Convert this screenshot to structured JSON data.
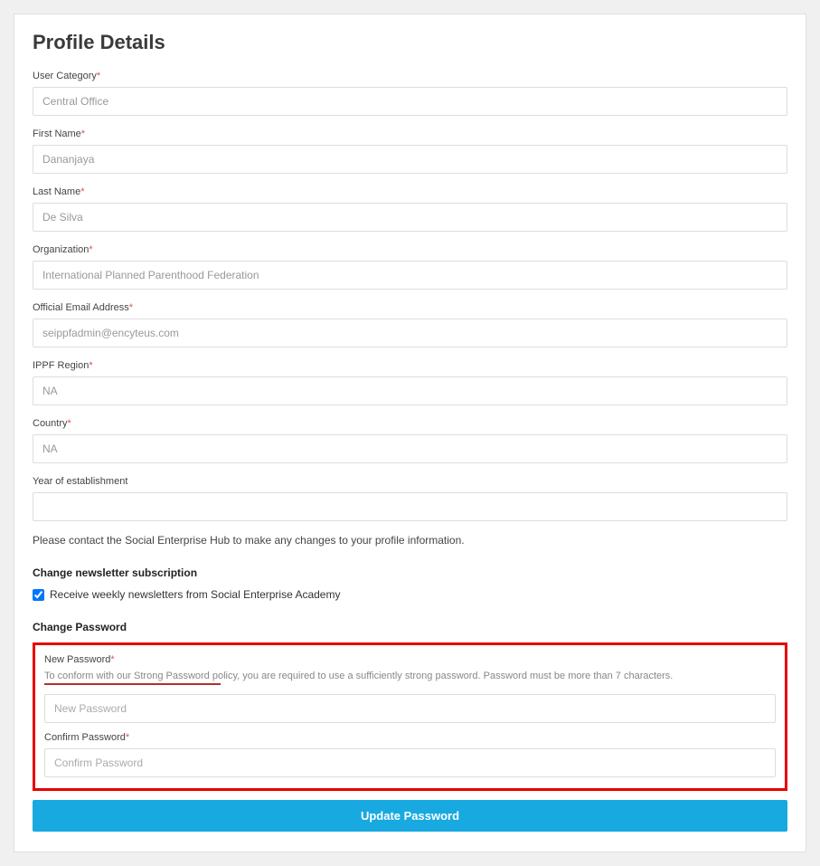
{
  "title": "Profile Details",
  "fields": {
    "user_category": {
      "label": "User Category",
      "value": "Central Office",
      "required": true
    },
    "first_name": {
      "label": "First Name",
      "value": "Dananjaya",
      "required": true
    },
    "last_name": {
      "label": "Last Name",
      "value": "De Silva",
      "required": true
    },
    "organization": {
      "label": "Organization",
      "value": "International Planned Parenthood Federation",
      "required": true
    },
    "email": {
      "label": "Official Email Address",
      "value": "seippfadmin@encyteus.com",
      "required": true
    },
    "region": {
      "label": "IPPF Region",
      "value": "NA",
      "required": true
    },
    "country": {
      "label": "Country",
      "value": "NA",
      "required": true
    },
    "year": {
      "label": "Year of establishment",
      "value": "",
      "required": false
    }
  },
  "contact_note": "Please contact the Social Enterprise Hub to make any changes to your profile information.",
  "newsletter": {
    "header": "Change newsletter subscription",
    "label": "Receive weekly newsletters from Social Enterprise Academy",
    "checked": true
  },
  "password": {
    "header": "Change Password",
    "new_label": "New Password",
    "new_placeholder": "New Password",
    "hint": "To conform with our Strong Password policy, you are required to use a sufficiently strong password. Password must be more than 7 characters.",
    "confirm_label": "Confirm Password",
    "confirm_placeholder": "Confirm Password"
  },
  "submit_label": "Update Password",
  "asterisk": "*"
}
